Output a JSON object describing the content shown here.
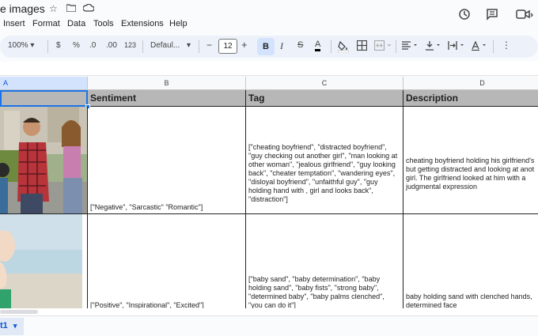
{
  "doc": {
    "title": "e images"
  },
  "menus": [
    "Insert",
    "Format",
    "Data",
    "Tools",
    "Extensions",
    "Help"
  ],
  "toolbar": {
    "zoom": "100%",
    "currency": "$",
    "percent": "%",
    "dec_decrease": ".0",
    "dec_increase": ".00",
    "number_format": "123",
    "font": "Defaul...",
    "minus": "−",
    "font_size": "12",
    "plus": "+",
    "bold": "B",
    "italic": "I",
    "strike": "S",
    "text_color": "A"
  },
  "columns": [
    "A",
    "B",
    "C",
    "D"
  ],
  "header_row": [
    "",
    "Sentiment",
    "Tag",
    "Description"
  ],
  "rows": [
    {
      "sentiment": "[\"Negative\", \"Sarcastic\" \"Romantic\"]",
      "tag": "[\"cheating boyfriend\", \"distracted boyfriend\", \"guy checking out another girl\", \"man looking at other woman\", \"jealous girlfriend\", \"guy looking back\", \"cheater temptation\", \"wandering eyes\", \"disloyal boyfriend\", \"unfaithful guy\", \"guy holding hand with , girl and looks back\", \"distraction\"]",
      "description": "cheating boyfriend holding his girlfriend's but getting distracted and looking at anot girl. The girlfriend looked at him with a judgmental expression"
    },
    {
      "sentiment": "[\"Positive\", \"Inspirational\", \"Excited\"]",
      "tag": "[\"baby sand\", \"baby determination\", \"baby holding sand\", \"baby fists\", \"strong baby\", \"determined baby\", \"baby palms clenched\", \"you can do it\"]",
      "description": "baby holding sand with clenched hands, determined face"
    }
  ],
  "sheet_tab": {
    "label": "t1"
  }
}
